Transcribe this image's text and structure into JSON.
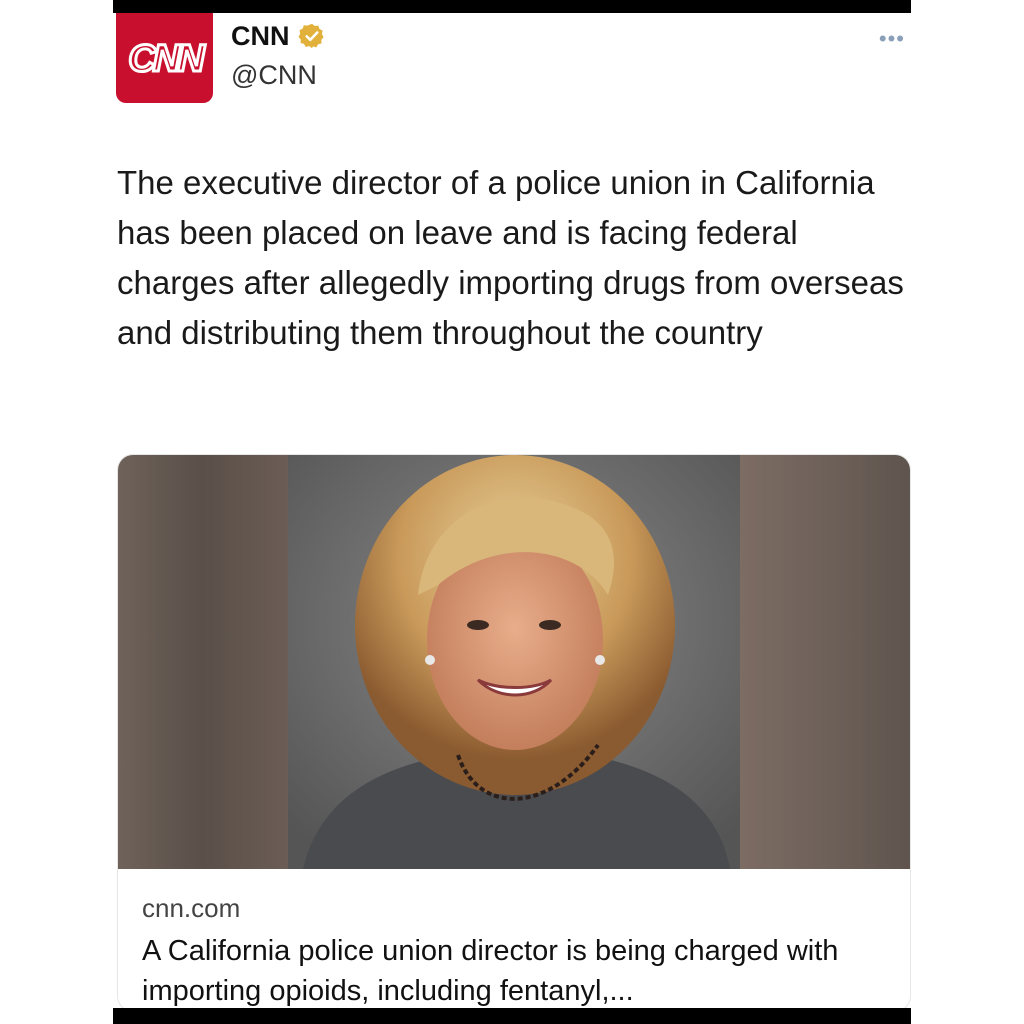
{
  "author": {
    "logo_text": "CNN",
    "display_name": "CNN",
    "handle": "@CNN",
    "verified_icon": "verified-badge-icon",
    "brand_color": "#c8102e"
  },
  "menu": {
    "more_label": "•••"
  },
  "tweet": {
    "text": "The executive director of a police union in California has been placed on leave and is facing federal charges after allegedly importing drugs from overseas and distributing them throughout the country"
  },
  "link_card": {
    "image_alt": "Portrait of a smiling woman with shoulder-length blonde hair wearing a dark top and beaded necklace",
    "domain": "cnn.com",
    "title": "A California police union director is being charged with importing opioids, including fentanyl,..."
  }
}
